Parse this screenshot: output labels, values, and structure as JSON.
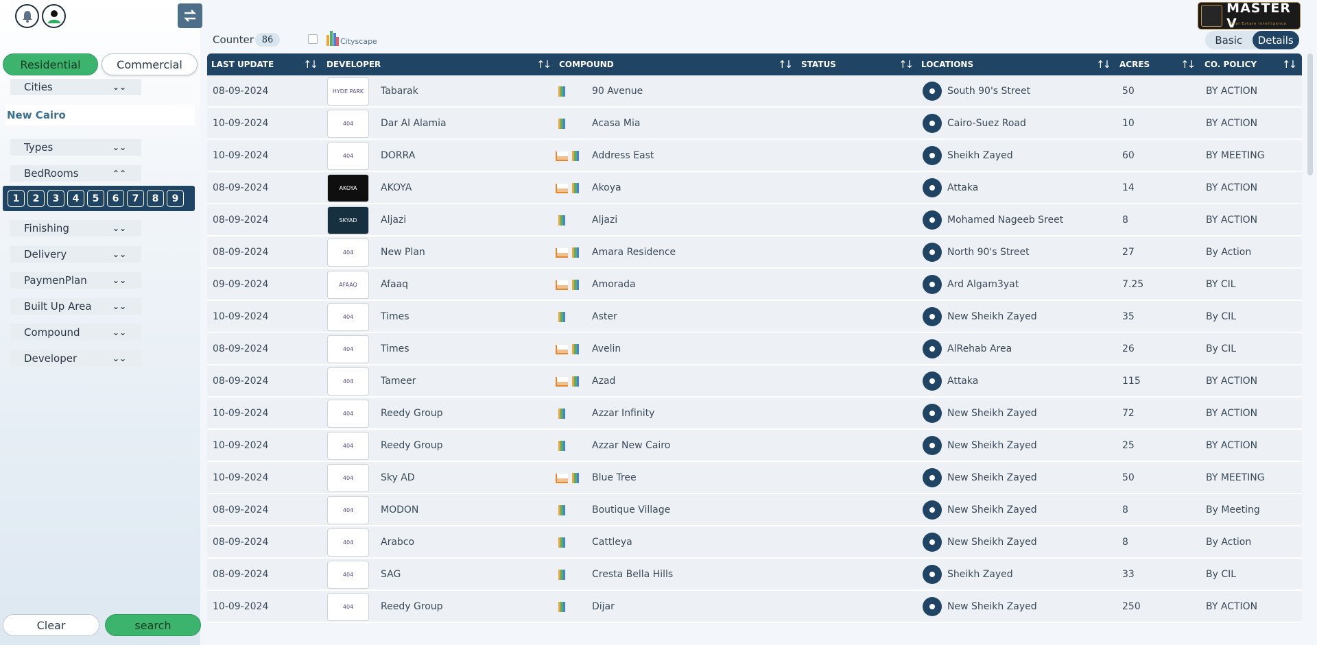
{
  "sidebar": {
    "tabs": [
      "Residential",
      "Commercial"
    ],
    "filters": {
      "cities": "Cities",
      "types": "Types",
      "bedrooms": "BedRooms",
      "finishing": "Finishing",
      "delivery": "Delivery",
      "paymentplan": "PaymenPlan",
      "builtup": "Built Up Area",
      "compound": "Compound",
      "developer": "Developer"
    },
    "selected_city": "New Cairo",
    "bedroom_numbers": [
      "1",
      "2",
      "3",
      "4",
      "5",
      "6",
      "7",
      "8",
      "9"
    ],
    "clear_label": "Clear",
    "search_label": "search"
  },
  "header": {
    "counter_label": "Counter",
    "counter_value": "86",
    "cityscape_label": "Cityscape",
    "brand": "MASTER V",
    "brand_sub": "Real Estate Intelligence",
    "view_basic": "Basic",
    "view_details": "Details"
  },
  "table": {
    "columns": [
      "LAST UPDATE",
      "DEVELOPER",
      "COMPOUND",
      "STATUS",
      "LOCATIONS",
      "ACRES",
      "CO. POLICY"
    ],
    "rows": [
      {
        "date": "08-09-2024",
        "developer": "Tabarak",
        "logo": "HYDE PARK",
        "compound": "90 Avenue",
        "location": "South 90's Street",
        "acres": "50",
        "policy": "BY ACTION",
        "master": false
      },
      {
        "date": "10-09-2024",
        "developer": "Dar Al Alamia",
        "logo": "404",
        "compound": "Acasa Mia",
        "location": "Cairo-Suez Road",
        "acres": "10",
        "policy": "BY ACTION",
        "master": false
      },
      {
        "date": "10-09-2024",
        "developer": "DORRA",
        "logo": "404",
        "compound": "Address East",
        "location": "Sheikh Zayed",
        "acres": "60",
        "policy": "BY MEETING",
        "master": true
      },
      {
        "date": "08-09-2024",
        "developer": "AKOYA",
        "logo": "AKOYA",
        "compound": "Akoya",
        "location": "Attaka",
        "acres": "14",
        "policy": "BY ACTION",
        "master": true
      },
      {
        "date": "08-09-2024",
        "developer": "Aljazi",
        "logo": "SKYAD",
        "compound": "Aljazi",
        "location": "Mohamed Nageeb Sreet",
        "acres": "8",
        "policy": "BY ACTION",
        "master": false
      },
      {
        "date": "08-09-2024",
        "developer": "New Plan",
        "logo": "404",
        "compound": "Amara Residence",
        "location": "North 90's Street",
        "acres": "27",
        "policy": "By Action",
        "master": true
      },
      {
        "date": "09-09-2024",
        "developer": "Afaaq",
        "logo": "AFAAQ",
        "compound": "Amorada",
        "location": "Ard Algam3yat",
        "acres": "7.25",
        "policy": "BY CIL",
        "master": true
      },
      {
        "date": "10-09-2024",
        "developer": "Times",
        "logo": "404",
        "compound": "Aster",
        "location": "New Sheikh Zayed",
        "acres": "35",
        "policy": "By CIL",
        "master": false
      },
      {
        "date": "08-09-2024",
        "developer": "Times",
        "logo": "404",
        "compound": "Avelin",
        "location": "AlRehab Area",
        "acres": "26",
        "policy": "By CIL",
        "master": true
      },
      {
        "date": "08-09-2024",
        "developer": "Tameer",
        "logo": "404",
        "compound": "Azad",
        "location": "Attaka",
        "acres": "115",
        "policy": "BY ACTION",
        "master": true
      },
      {
        "date": "10-09-2024",
        "developer": "Reedy Group",
        "logo": "404",
        "compound": "Azzar Infinity",
        "location": "New Sheikh Zayed",
        "acres": "72",
        "policy": "BY ACTION",
        "master": false
      },
      {
        "date": "10-09-2024",
        "developer": "Reedy Group",
        "logo": "404",
        "compound": "Azzar New Cairo",
        "location": "New Sheikh Zayed",
        "acres": "25",
        "policy": "BY ACTION",
        "master": false
      },
      {
        "date": "10-09-2024",
        "developer": "Sky AD",
        "logo": "404",
        "compound": "Blue Tree",
        "location": "New Sheikh Zayed",
        "acres": "50",
        "policy": "BY MEETING",
        "master": true
      },
      {
        "date": "08-09-2024",
        "developer": "MODON",
        "logo": "404",
        "compound": "Boutique Village",
        "location": "New Sheikh Zayed",
        "acres": "8",
        "policy": "By Meeting",
        "master": false
      },
      {
        "date": "08-09-2024",
        "developer": "Arabco",
        "logo": "404",
        "compound": "Cattleya",
        "location": "New Sheikh Zayed",
        "acres": "8",
        "policy": "By Action",
        "master": false
      },
      {
        "date": "08-09-2024",
        "developer": "SAG",
        "logo": "404",
        "compound": "Cresta Bella Hills",
        "location": "Sheikh Zayed",
        "acres": "33",
        "policy": "By CIL",
        "master": false
      },
      {
        "date": "10-09-2024",
        "developer": "Reedy Group",
        "logo": "404",
        "compound": "Dijar",
        "location": "New Sheikh Zayed",
        "acres": "250",
        "policy": "BY ACTION",
        "master": false
      }
    ]
  }
}
